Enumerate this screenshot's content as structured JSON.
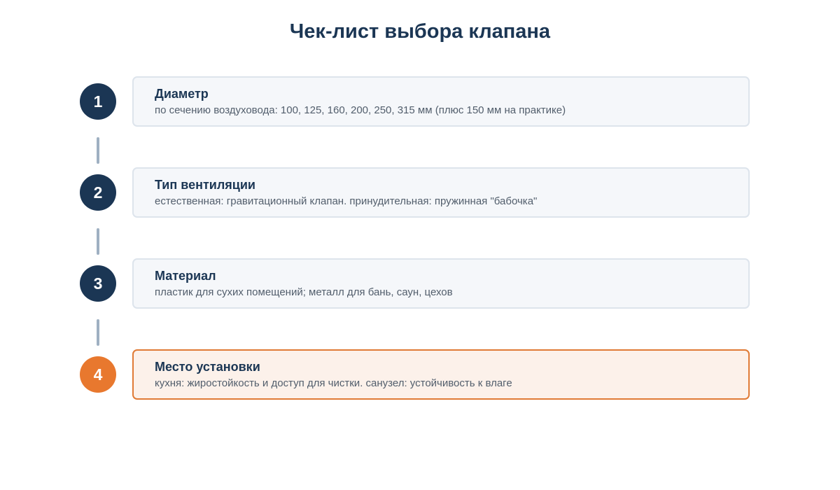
{
  "title": "Чек-лист выбора клапана",
  "colors": {
    "primary": "#1b3654",
    "accent": "#e8782e",
    "card_bg": "#f5f7fa",
    "card_border": "#dde4ec",
    "accent_card_bg": "#fcf1ea",
    "connector": "#9fb0c2"
  },
  "steps": [
    {
      "number": "1",
      "title": "Диаметр",
      "description": "по сечению воздуховода: 100, 125, 160, 200, 250, 315 мм (плюс 150 мм на практике)",
      "highlighted": false
    },
    {
      "number": "2",
      "title": "Тип вентиляции",
      "description": "естественная: гравитационный клапан. принудительная: пружинная \"бабочка\"",
      "highlighted": false
    },
    {
      "number": "3",
      "title": "Материал",
      "description": "пластик для сухих помещений; металл для бань, саун, цехов",
      "highlighted": false
    },
    {
      "number": "4",
      "title": "Место установки",
      "description": "кухня: жиростойкость и доступ для чистки. санузел: устойчивость к влаге",
      "highlighted": true
    }
  ]
}
